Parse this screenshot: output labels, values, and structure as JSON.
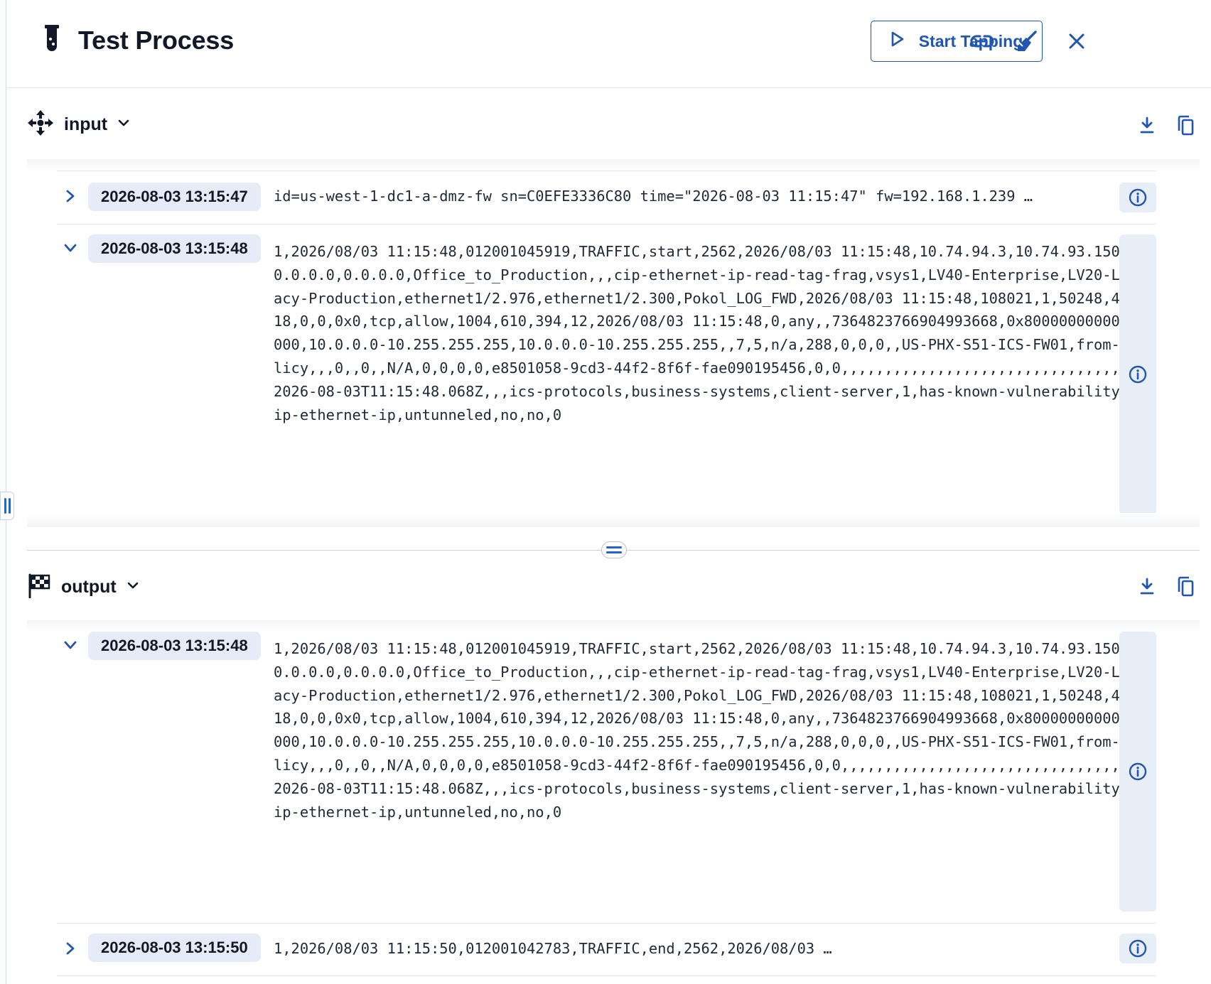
{
  "header": {
    "title": "Test Process",
    "start_button_label": "Start Tapping",
    "title_icon": "test-tube-icon",
    "actions": [
      "link-icon",
      "broom-icon",
      "close-icon"
    ]
  },
  "input": {
    "title": "input",
    "icon": "nodes-arrows-icon",
    "actions": [
      "download-icon",
      "copy-icon"
    ],
    "events": [
      {
        "timestamp": "2026-08-03 13:15:47",
        "expanded": false,
        "message": "id=us-west-1-dc1-a-dmz-fw sn=C0EFE3336C80 time=\"2026-08-03 11:15:47\" fw=192.168.1.239 …"
      },
      {
        "timestamp": "2026-08-03 13:15:48",
        "expanded": true,
        "message": "1,2026/08/03 11:15:48,012001045919,TRAFFIC,start,2562,2026/08/03 11:15:48,10.74.94.3,10.74.93.150,0.0.0.0,0.0.0.0,Office_to_Production,,,cip-ethernet-ip-read-tag-frag,vsys1,LV40-Enterprise,LV20-Legacy-Production,ethernet1/2.976,ethernet1/2.300,Pokol_LOG_FWD,2026/08/03 11:15:48,108021,1,50248,44818,0,0,0x0,tcp,allow,1004,610,394,12,2026/08/03 11:15:48,0,any,,7364823766904993668,0x8000000000000000,10.0.0.0-10.255.255.255,10.0.0.0-10.255.255.255,,7,5,n/a,288,0,0,0,,US-PHX-S51-ICS-FW01,from-policy,,,0,,0,,N/A,0,0,0,0,e8501058-9cd3-44f2-8f6f-fae090195456,0,0,,,,,,,,,,,,,,,,,,,,,,,,,,,,,,,,,,2026-08-03T11:15:48.068Z,,,ics-protocols,business-systems,client-server,1,has-known-vulnerability,cip-ethernet-ip,untunneled,no,no,0"
      }
    ]
  },
  "output": {
    "title": "output",
    "icon": "checkered-flag-icon",
    "actions": [
      "download-icon",
      "copy-icon"
    ],
    "events": [
      {
        "timestamp": "2026-08-03 13:15:48",
        "expanded": true,
        "message": "1,2026/08/03 11:15:48,012001045919,TRAFFIC,start,2562,2026/08/03 11:15:48,10.74.94.3,10.74.93.150,0.0.0.0,0.0.0.0,Office_to_Production,,,cip-ethernet-ip-read-tag-frag,vsys1,LV40-Enterprise,LV20-Legacy-Production,ethernet1/2.976,ethernet1/2.300,Pokol_LOG_FWD,2026/08/03 11:15:48,108021,1,50248,44818,0,0,0x0,tcp,allow,1004,610,394,12,2026/08/03 11:15:48,0,any,,7364823766904993668,0x8000000000000000,10.0.0.0-10.255.255.255,10.0.0.0-10.255.255.255,,7,5,n/a,288,0,0,0,,US-PHX-S51-ICS-FW01,from-policy,,,0,,0,,N/A,0,0,0,0,e8501058-9cd3-44f2-8f6f-fae090195456,0,0,,,,,,,,,,,,,,,,,,,,,,,,,,,,,,,,,,2026-08-03T11:15:48.068Z,,,ics-protocols,business-systems,client-server,1,has-known-vulnerability,cip-ethernet-ip,untunneled,no,no,0"
      },
      {
        "timestamp": "2026-08-03 13:15:50",
        "expanded": false,
        "message": "1,2026/08/03 11:15:50,012001042783,TRAFFIC,end,2562,2026/08/03 …"
      }
    ]
  },
  "colors": {
    "accent": "#2055b0",
    "timestamp_bg": "#e5ecf7",
    "info_bg": "#e8eef7"
  }
}
